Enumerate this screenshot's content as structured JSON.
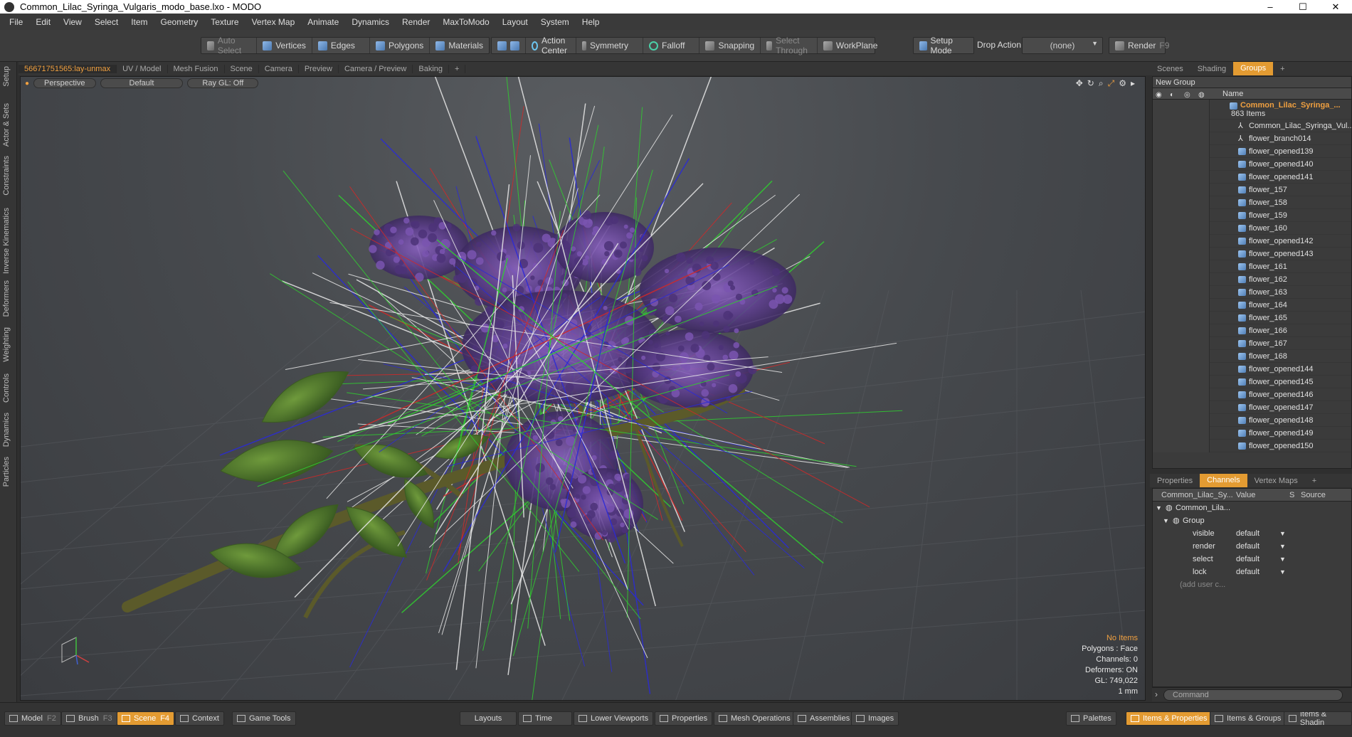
{
  "window": {
    "title": "Common_Lilac_Syringa_Vulgaris_modo_base.lxo - MODO",
    "minimize": "–",
    "maximize": "☐",
    "close": "✕"
  },
  "menu": [
    "File",
    "Edit",
    "View",
    "Select",
    "Item",
    "Geometry",
    "Texture",
    "Vertex Map",
    "Animate",
    "Dynamics",
    "Render",
    "MaxToModo",
    "Layout",
    "System",
    "Help"
  ],
  "toolbar": {
    "auto_select": "Auto Select",
    "vertices": "Vertices",
    "edges": "Edges",
    "polygons": "Polygons",
    "materials": "Materials",
    "action_center": "Action Center",
    "symmetry": "Symmetry",
    "falloff": "Falloff",
    "snapping": "Snapping",
    "select_through": "Select Through",
    "workplane": "WorkPlane",
    "setup_mode": "Setup Mode",
    "drop_action": "Drop Action",
    "drop_value": "(none)",
    "render": "Render",
    "render_key": "F9"
  },
  "left_tabs": [
    "Setup",
    "Actor & Sets",
    "Constraints",
    "Inverse Kinematics",
    "Deformers",
    "Weighting",
    "Controls",
    "Dynamics",
    "Particles"
  ],
  "viewport_tabs": [
    "56671751565:lay-unmax",
    "UV / Model",
    "Mesh Fusion",
    "Scene",
    "Camera",
    "Preview",
    "Camera / Preview",
    "Baking",
    "+"
  ],
  "viewport": {
    "view": "Perspective",
    "shading": "Default",
    "raygl": "Ray GL: Off",
    "info": {
      "items": "No Items",
      "polygons": "Polygons : Face",
      "channels": "Channels: 0",
      "deformers": "Deformers: ON",
      "gl": "GL: 749,022",
      "unit": "1 mm"
    }
  },
  "right_tabs": [
    "Scenes",
    "Shading",
    "Groups",
    "+"
  ],
  "groups": {
    "new_group": "New Group",
    "col_name": "Name",
    "group_name": "Common_Lilac_Syringa_...",
    "group_count": "863 Items",
    "items": [
      "Common_Lilac_Syringa_Vul...",
      "flower_branch014",
      "flower_opened139",
      "flower_opened140",
      "flower_opened141",
      "flower_157",
      "flower_158",
      "flower_159",
      "flower_160",
      "flower_opened142",
      "flower_opened143",
      "flower_161",
      "flower_162",
      "flower_163",
      "flower_164",
      "flower_165",
      "flower_166",
      "flower_167",
      "flower_168",
      "flower_opened144",
      "flower_opened145",
      "flower_opened146",
      "flower_opened147",
      "flower_opened148",
      "flower_opened149",
      "flower_opened150"
    ]
  },
  "channel_tabs": [
    "Properties",
    "Channels",
    "Vertex Maps",
    "+"
  ],
  "channels": {
    "col_item": "Common_Lilac_Sy...",
    "col_value": "Value",
    "col_s": "S",
    "col_source": "Source",
    "root": "Common_Lila...",
    "group": "Group",
    "rows": [
      {
        "name": "visible",
        "value": "default"
      },
      {
        "name": "render",
        "value": "default"
      },
      {
        "name": "select",
        "value": "default"
      },
      {
        "name": "lock",
        "value": "default"
      }
    ],
    "add_user": "(add user c..."
  },
  "command_placeholder": "Command",
  "bottom": {
    "model": "Model",
    "model_key": "F2",
    "brush": "Brush",
    "brush_key": "F3",
    "scene": "Scene",
    "scene_key": "F4",
    "context": "Context",
    "game_tools": "Game Tools",
    "layouts": "Layouts",
    "time": "Time",
    "lower_viewports": "Lower Viewports",
    "properties": "Properties",
    "mesh_operations": "Mesh Operations",
    "assemblies": "Assemblies",
    "images": "Images",
    "palettes": "Palettes",
    "items_properties": "Items & Properties",
    "items_groups": "Items & Groups",
    "items_shading": "Items & Shadin"
  },
  "colors": {
    "accent": "#e39b32",
    "highlight": "#f0a040"
  }
}
